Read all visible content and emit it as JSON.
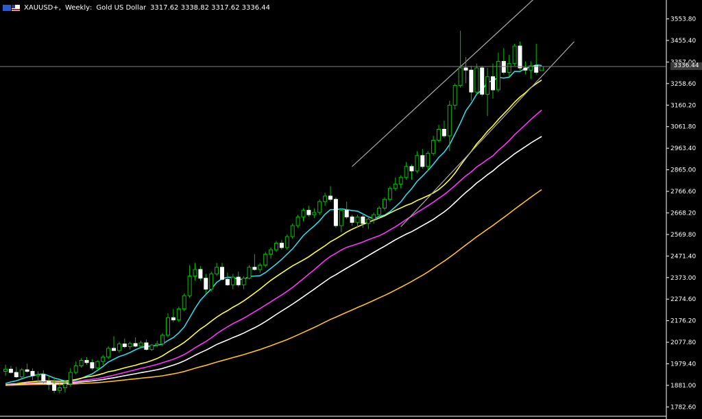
{
  "header": {
    "symbol": "XAUUSD+",
    "timeframe": "Weekly",
    "description": "Gold US Dollar",
    "ohlc": "3317.62 3338.82 3317.62 3336.44"
  },
  "colors": {
    "background": "#000000",
    "axis": "#ffffff",
    "bull_candle": "#ccffaa",
    "bear_candle": "#ffffff",
    "wick": "#00c000",
    "ma20": "#33d6e6",
    "ma50": "#ffff33",
    "ma100": "#ff33ff",
    "ma150": "#ffffff",
    "ma200": "#ffc020",
    "channel": "#a0a0a0",
    "price_line": "#808080"
  },
  "chart_data": {
    "type": "candlestick",
    "ylim": [
      1740,
      3640
    ],
    "y_ticks": [
      "3553.80",
      "3455.40",
      "3357.00",
      "3258.60",
      "3160.20",
      "3061.80",
      "2963.40",
      "2865.00",
      "2766.60",
      "2668.20",
      "2569.80",
      "2471.40",
      "2373.00",
      "2274.60",
      "2176.20",
      "2077.80",
      "1979.40",
      "1881.00",
      "1782.60"
    ],
    "current_price_label": "3336.44",
    "current_price": 3336.44,
    "candles": [
      [
        1945,
        1975,
        1925,
        1955
      ],
      [
        1955,
        1970,
        1935,
        1940
      ],
      [
        1940,
        1965,
        1915,
        1920
      ],
      [
        1920,
        1960,
        1912,
        1952
      ],
      [
        1952,
        1980,
        1938,
        1945
      ],
      [
        1945,
        1958,
        1905,
        1925
      ],
      [
        1925,
        1945,
        1895,
        1930
      ],
      [
        1930,
        1950,
        1890,
        1900
      ],
      [
        1900,
        1925,
        1860,
        1885
      ],
      [
        1885,
        1920,
        1845,
        1858
      ],
      [
        1858,
        1890,
        1845,
        1870
      ],
      [
        1870,
        1905,
        1848,
        1888
      ],
      [
        1888,
        1960,
        1875,
        1940
      ],
      [
        1940,
        1990,
        1932,
        1970
      ],
      [
        1970,
        2005,
        1962,
        1995
      ],
      [
        1995,
        2010,
        1975,
        1985
      ],
      [
        1985,
        2000,
        1952,
        1960
      ],
      [
        1960,
        1995,
        1955,
        1990
      ],
      [
        1990,
        2020,
        1975,
        2010
      ],
      [
        2010,
        2060,
        2000,
        2050
      ],
      [
        2050,
        2105,
        2040,
        2040
      ],
      [
        2040,
        2080,
        2030,
        2070
      ],
      [
        2070,
        2095,
        2050,
        2058
      ],
      [
        2058,
        2080,
        2045,
        2072
      ],
      [
        2072,
        2100,
        2055,
        2060
      ],
      [
        2060,
        2085,
        2050,
        2075
      ],
      [
        2075,
        2090,
        2040,
        2045
      ],
      [
        2045,
        2070,
        2038,
        2065
      ],
      [
        2065,
        2085,
        2055,
        2070
      ],
      [
        2070,
        2120,
        2060,
        2110
      ],
      [
        2110,
        2210,
        2100,
        2190
      ],
      [
        2190,
        2230,
        2170,
        2180
      ],
      [
        2180,
        2240,
        2170,
        2230
      ],
      [
        2230,
        2300,
        2220,
        2290
      ],
      [
        2290,
        2430,
        2280,
        2380
      ],
      [
        2380,
        2440,
        2360,
        2410
      ],
      [
        2410,
        2425,
        2360,
        2370
      ],
      [
        2370,
        2390,
        2300,
        2320
      ],
      [
        2320,
        2400,
        2310,
        2390
      ],
      [
        2390,
        2440,
        2380,
        2420
      ],
      [
        2420,
        2440,
        2360,
        2365
      ],
      [
        2365,
        2395,
        2335,
        2340
      ],
      [
        2340,
        2390,
        2320,
        2375
      ],
      [
        2375,
        2400,
        2330,
        2340
      ],
      [
        2340,
        2380,
        2320,
        2370
      ],
      [
        2370,
        2430,
        2365,
        2420
      ],
      [
        2420,
        2480,
        2405,
        2410
      ],
      [
        2410,
        2440,
        2395,
        2430
      ],
      [
        2430,
        2490,
        2420,
        2480
      ],
      [
        2480,
        2510,
        2460,
        2500
      ],
      [
        2500,
        2540,
        2490,
        2530
      ],
      [
        2530,
        2545,
        2500,
        2510
      ],
      [
        2510,
        2570,
        2500,
        2560
      ],
      [
        2560,
        2620,
        2550,
        2610
      ],
      [
        2610,
        2660,
        2600,
        2650
      ],
      [
        2650,
        2690,
        2630,
        2680
      ],
      [
        2680,
        2700,
        2650,
        2660
      ],
      [
        2660,
        2690,
        2645,
        2670
      ],
      [
        2670,
        2730,
        2660,
        2720
      ],
      [
        2720,
        2760,
        2700,
        2745
      ],
      [
        2745,
        2790,
        2720,
        2730
      ],
      [
        2730,
        2740,
        2600,
        2610
      ],
      [
        2610,
        2690,
        2580,
        2680
      ],
      [
        2680,
        2720,
        2640,
        2650
      ],
      [
        2650,
        2660,
        2610,
        2625
      ],
      [
        2625,
        2660,
        2600,
        2650
      ],
      [
        2650,
        2665,
        2600,
        2620
      ],
      [
        2620,
        2650,
        2595,
        2640
      ],
      [
        2640,
        2670,
        2620,
        2660
      ],
      [
        2660,
        2700,
        2650,
        2690
      ],
      [
        2690,
        2740,
        2680,
        2730
      ],
      [
        2730,
        2790,
        2720,
        2780
      ],
      [
        2780,
        2830,
        2770,
        2800
      ],
      [
        2800,
        2840,
        2780,
        2830
      ],
      [
        2830,
        2900,
        2820,
        2880
      ],
      [
        2880,
        2890,
        2820,
        2860
      ],
      [
        2860,
        2950,
        2850,
        2930
      ],
      [
        2930,
        2960,
        2870,
        2880
      ],
      [
        2880,
        2950,
        2860,
        2940
      ],
      [
        2940,
        3020,
        2930,
        3000
      ],
      [
        3000,
        3070,
        2990,
        3050
      ],
      [
        3050,
        3090,
        3010,
        3020
      ],
      [
        3020,
        3180,
        2950,
        3160
      ],
      [
        3160,
        3260,
        3140,
        3250
      ],
      [
        3250,
        3500,
        3240,
        3330
      ],
      [
        3330,
        3380,
        3260,
        3320
      ],
      [
        3320,
        3340,
        3180,
        3220
      ],
      [
        3220,
        3350,
        3210,
        3330
      ],
      [
        3330,
        3340,
        3200,
        3210
      ],
      [
        3210,
        3330,
        3110,
        3290
      ],
      [
        3290,
        3350,
        3190,
        3230
      ],
      [
        3230,
        3400,
        3220,
        3360
      ],
      [
        3360,
        3420,
        3300,
        3310
      ],
      [
        3310,
        3390,
        3290,
        3350
      ],
      [
        3350,
        3440,
        3340,
        3430
      ],
      [
        3430,
        3450,
        3320,
        3330
      ],
      [
        3330,
        3360,
        3300,
        3320
      ],
      [
        3320,
        3360,
        3280,
        3340
      ],
      [
        3340,
        3440,
        3300,
        3310
      ],
      [
        3317.62,
        3338.82,
        3317.62,
        3336.44
      ]
    ]
  }
}
